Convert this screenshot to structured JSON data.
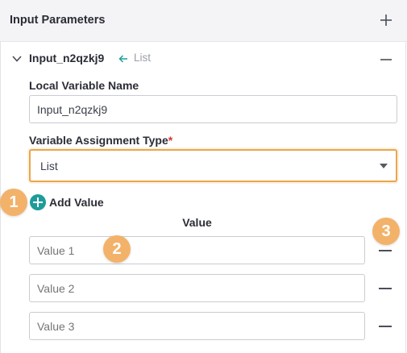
{
  "header": {
    "title": "Input Parameters",
    "add_icon": "plus-icon"
  },
  "input": {
    "name": "Input_n2qzkj9",
    "type_tag": "List",
    "expand_icon": "chevron-down-icon",
    "link_icon": "arrow-left-icon",
    "collapse_icon": "minus-icon"
  },
  "local_variable": {
    "label": "Local Variable Name",
    "value": "Input_n2qzkj9"
  },
  "assignment_type": {
    "label": "Variable Assignment Type",
    "required_mark": "*",
    "selected": "List",
    "focus_color": "#e9a64a"
  },
  "add_value": {
    "label": "Add Value",
    "icon": "plus-circle-icon",
    "icon_color": "#1e9c9a"
  },
  "values_table": {
    "column_header": "Value",
    "rows": [
      {
        "placeholder": "Value 1"
      },
      {
        "placeholder": "Value 2"
      },
      {
        "placeholder": "Value 3"
      }
    ]
  },
  "callouts": [
    {
      "number": "1"
    },
    {
      "number": "2"
    },
    {
      "number": "3"
    }
  ],
  "callout_color": "#f3b26a"
}
